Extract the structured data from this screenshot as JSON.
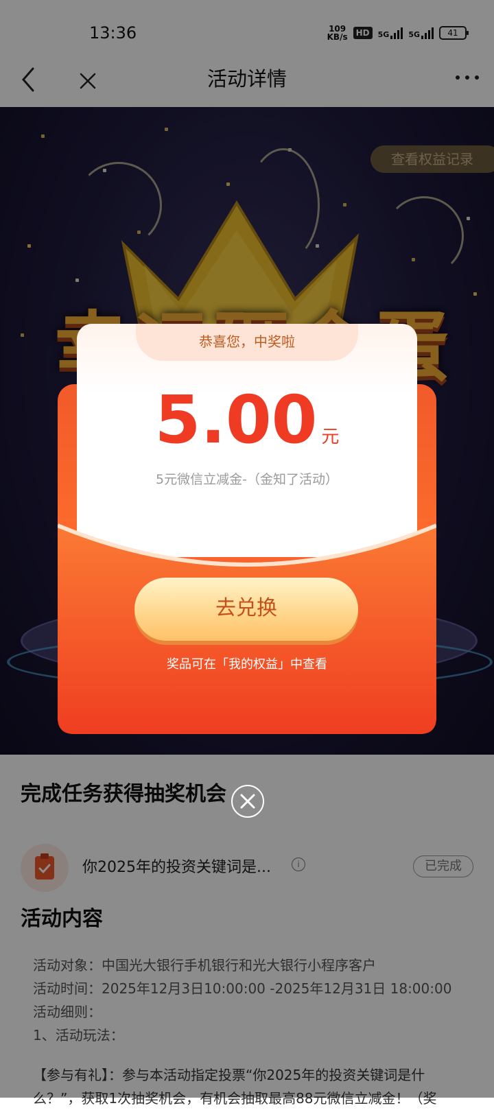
{
  "status_bar": {
    "time": "13:36",
    "net_speed_value": "109",
    "net_speed_unit": "KB/s",
    "hd_label": "HD",
    "signal1_label": "5G",
    "signal2_label": "5G",
    "battery": "41"
  },
  "nav": {
    "title": "活动详情",
    "back_icon": "chevron-left-icon",
    "close_icon": "close-icon",
    "more_icon": "more-horizontal-icon"
  },
  "banner": {
    "title": "幸运砸金蛋",
    "records_button": "查看权益记录",
    "colors": {
      "bg": "#1e1a3c",
      "gold": "#f7b036"
    }
  },
  "prize_modal": {
    "congrats": "恭喜您，中奖啦",
    "amount": "5.00",
    "unit": "元",
    "description": "5元微信立减金-（金知了活动）",
    "redeem_button": "去兑换",
    "hint": "奖品可在「我的权益」中查看",
    "close_icon": "close-circle-icon",
    "colors": {
      "red": "#ef3b23",
      "orange": "#fb6a2c",
      "button_gold": "#ffd58a"
    }
  },
  "tasks": {
    "section_title": "完成任务获得抽奖机会",
    "items": [
      {
        "icon": "clipboard-check-icon",
        "text": "你2025年的投资关键词是...",
        "info_icon": "info-icon",
        "status": "已完成"
      }
    ]
  },
  "activity": {
    "section_title": "活动内容",
    "lines": [
      "活动对象：中国光大银行手机银行和光大银行小程序客户",
      "活动时间：2025年12月3日10:00:00 -2025年12月31日 18:00:00",
      "活动细则：",
      "1、活动玩法："
    ],
    "rule": "【参与有礼】：参与本活动指定投票“你2025年的投资关键词是什么？”，获取1次抽奖机会，有机会抽取最高88元微信立减金！（奖"
  }
}
